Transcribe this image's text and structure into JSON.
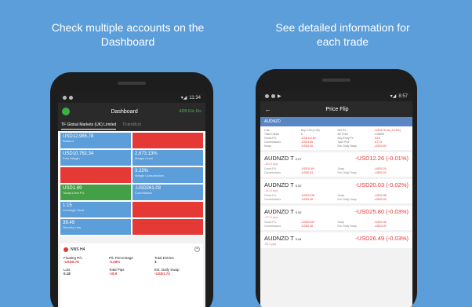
{
  "left": {
    "caption": "Check multiple accounts on the\nDashboard",
    "statusbar": {
      "time": "11:34"
    },
    "header": {
      "title": "Dashboard",
      "account_badge": "ADB Etic Etc"
    },
    "tabs": [
      {
        "label": "TF Global Markets (UK) Limited",
        "active": true
      },
      {
        "label": "TickmillLtd",
        "active": false
      }
    ],
    "tiles": [
      {
        "value": "USD12,985.78",
        "label": "Balance",
        "color": "#5b9ed9"
      },
      {
        "value": "",
        "label": "",
        "color": "#e53935"
      },
      {
        "value": "USD10,762.34",
        "label": "Free Margin",
        "color": "#5b9ed9"
      },
      {
        "value": "2,673.13%",
        "label": "Margin Level",
        "color": "#5b9ed9"
      },
      {
        "value": "",
        "label": "",
        "color": "#e53935"
      },
      {
        "value": "3.22%",
        "label": "Margin Consumption",
        "color": "#5b9ed9"
      },
      {
        "value": "USD1.69",
        "label": "Today's Net P/L",
        "color": "#43a047"
      },
      {
        "value": "-USD261.03",
        "label": "Commission",
        "color": "#5b9ed9"
      },
      {
        "value": "1:15",
        "label": "Leverage Used",
        "color": "#5b9ed9"
      },
      {
        "value": "",
        "label": "",
        "color": "#e53935"
      },
      {
        "value": "39.49",
        "label": "Security Lots",
        "color": "#5b9ed9"
      },
      {
        "value": "",
        "label": "",
        "color": "#e53935"
      }
    ],
    "position": {
      "symbol": "NNS H4",
      "stats": [
        {
          "label": "Floating P/L",
          "value": "-USD8.78",
          "tone": "red"
        },
        {
          "label": "P/L Percentage",
          "value": "-0.06%",
          "tone": "red"
        },
        {
          "label": "Total Entries",
          "value": "3",
          "tone": "neutral"
        },
        {
          "label": "Lots",
          "value": "0.18",
          "tone": "neutral"
        },
        {
          "label": "Total Pips",
          "value": "-18.9",
          "tone": "red"
        },
        {
          "label": "Est. Daily Swap",
          "value": "-USD1.74",
          "tone": "red"
        }
      ]
    }
  },
  "right": {
    "caption": "See detailed information for\neach trade",
    "statusbar": {
      "time": "8:57"
    },
    "header": {
      "title": "Price Flip"
    },
    "pair": "AUDNZD",
    "summary": [
      {
        "text": "Lots",
        "red": false
      },
      {
        "text": "Buy 0.69 (0.30)",
        "red": false
      },
      {
        "text": "Net P/L",
        "red": false
      },
      {
        "text": "-USD175.26 (-0.15%)",
        "red": true
      },
      {
        "text": "Total Entries",
        "red": false
      },
      {
        "text": "8",
        "red": false
      },
      {
        "text": "BE Price",
        "red": false
      },
      {
        "text": "1.08856",
        "red": false
      },
      {
        "text": "Gross P/L",
        "red": false
      },
      {
        "text": "-USD112.84",
        "red": true
      },
      {
        "text": "Avg Entry Px",
        "red": false
      },
      {
        "text": "-61.6",
        "red": true
      },
      {
        "text": "Commissions",
        "red": false
      },
      {
        "text": "-USD3.65",
        "red": true
      },
      {
        "text": "Take Prof.",
        "red": false
      },
      {
        "text": "-677.6",
        "red": true
      },
      {
        "text": "Swap",
        "red": false
      },
      {
        "text": "-USD4.58",
        "red": true
      },
      {
        "text": "Est. Daily Swap",
        "red": false
      },
      {
        "text": "-USD0.69",
        "red": true
      }
    ],
    "trades": [
      {
        "pair": "AUDNZD T",
        "size": "0.07",
        "pl": "-USD12.26 (-0.01%)",
        "sub": "-183.9 pips",
        "rows": [
          [
            "Gross P/L",
            "-USD11.84",
            "Swap",
            "-USD0.29"
          ],
          [
            "Commissions",
            "-USD0.03",
            "Est. Daily Swap",
            "-USD0.03"
          ]
        ]
      },
      {
        "pair": "AUDNZD T",
        "size": "0.02",
        "pl": "-USD20.03 (-0.02%)",
        "sub": "-141.6 pips",
        "rows": [
          [
            "Gross P/L",
            "-USD19.96",
            "Swap",
            "-USD0.58"
          ],
          [
            "Commissions",
            "-USD0.08",
            "Est. Daily Swap",
            "-USD0.09"
          ]
        ]
      },
      {
        "pair": "AUDNZD T",
        "size": "0.02",
        "pl": "-USD25.80 (-0.03%)",
        "sub": "-177.0 pips",
        "rows": [
          [
            "Gross P/L",
            "-USD24.63",
            "Swap",
            "-USD0.98"
          ],
          [
            "Commissions",
            "-USD0.08",
            "Est. Daily Swap",
            "-USD0.09"
          ]
        ]
      },
      {
        "pair": "AUDNZD T",
        "size": "0.04",
        "pl": "-USD26.49 (-0.03%)",
        "sub": "-95.1 pips",
        "rows": []
      }
    ]
  }
}
